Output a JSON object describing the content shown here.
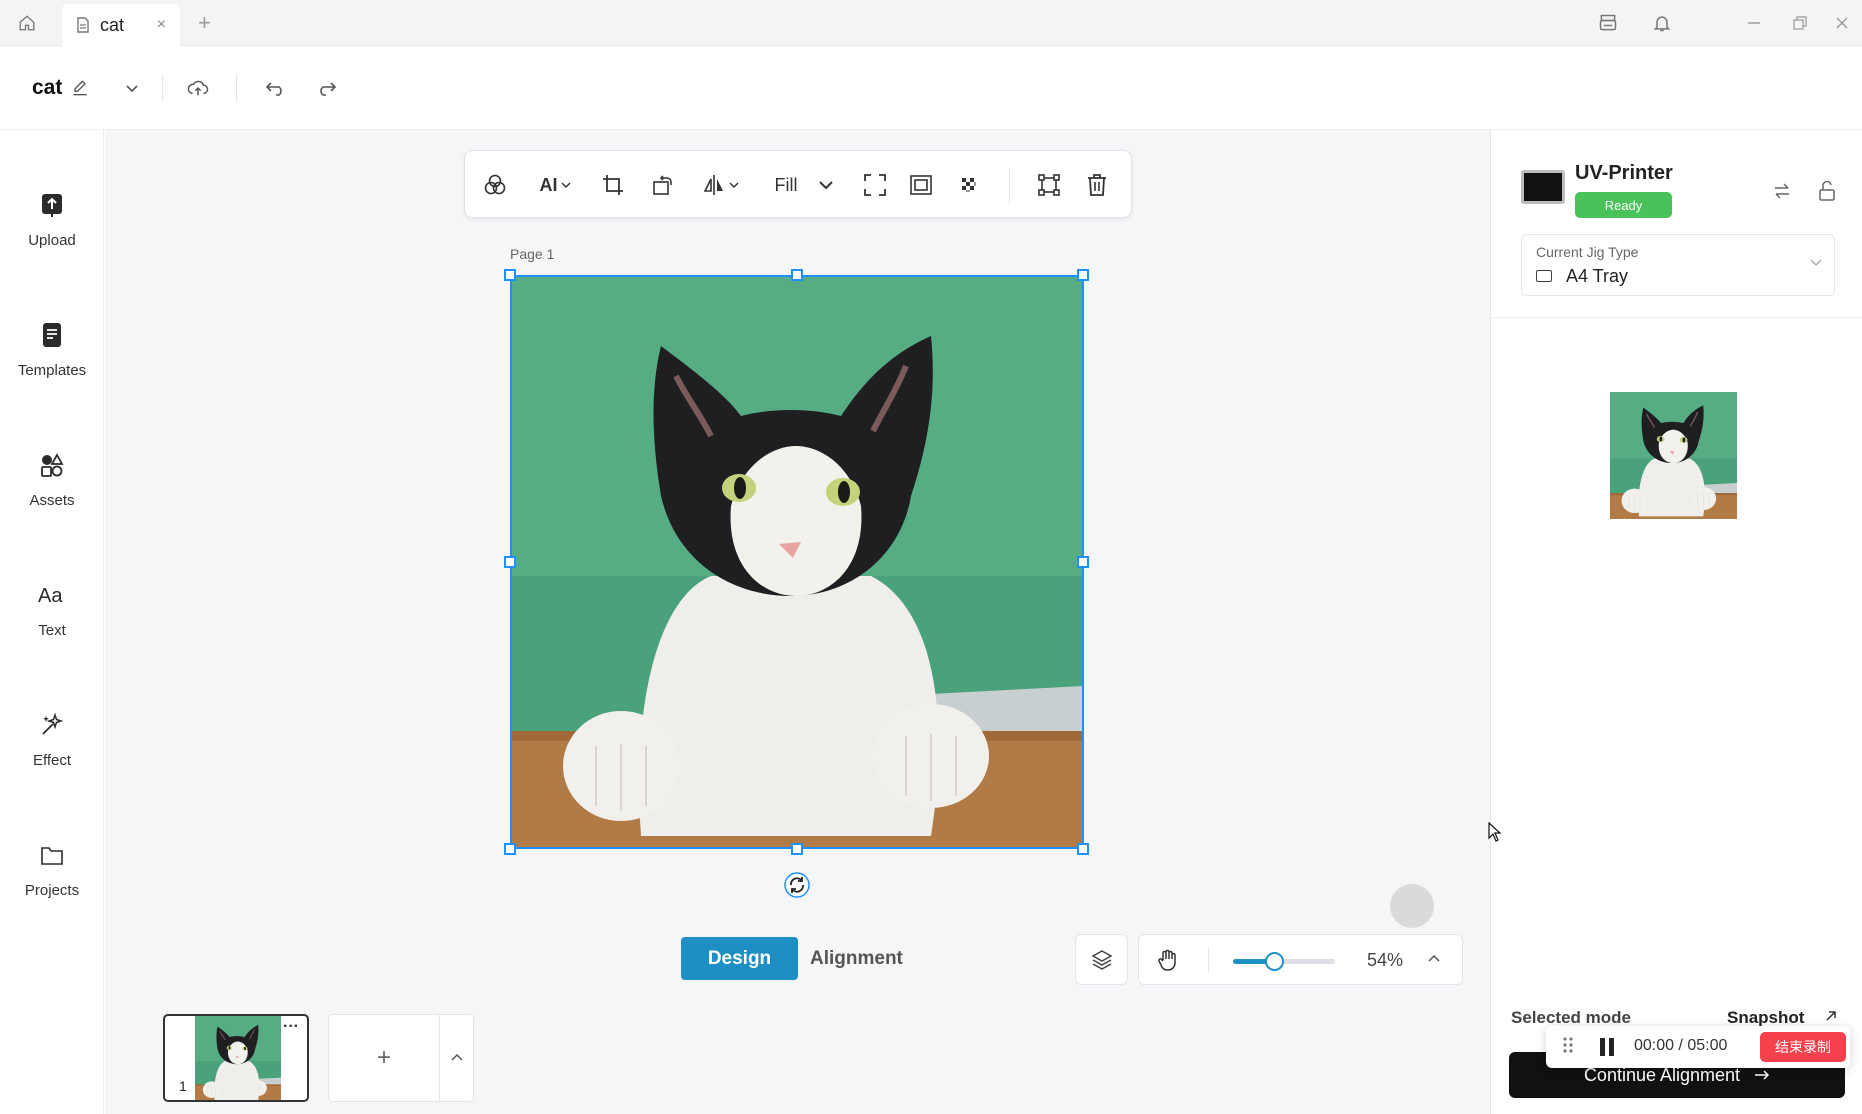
{
  "titlebar": {
    "tab_label": "cat",
    "tab_close": "×",
    "new_tab": "+"
  },
  "header": {
    "doc_title": "cat"
  },
  "sidebar": {
    "items": [
      {
        "label": "Upload",
        "icon": "upload-icon"
      },
      {
        "label": "Templates",
        "icon": "templates-icon"
      },
      {
        "label": "Assets",
        "icon": "assets-icon"
      },
      {
        "label": "Text",
        "icon": "text-icon"
      },
      {
        "label": "Effect",
        "icon": "effect-icon"
      },
      {
        "label": "Projects",
        "icon": "folder-icon"
      }
    ]
  },
  "toolbar": {
    "ai_label": "AI",
    "fill_label": "Fill"
  },
  "canvas": {
    "page_label": "Page 1"
  },
  "modes": {
    "design": "Design",
    "alignment": "Alignment",
    "active": "Design"
  },
  "zoom": {
    "value_label": "54%",
    "slider_fraction": 0.4
  },
  "pages": {
    "thumb_number": "1",
    "thumb_more": "···",
    "add_label": "+"
  },
  "printer": {
    "name": "UV-Printer",
    "status": "Ready",
    "status_color": "#4ac25a",
    "jig_label": "Current Jig Type",
    "jig_value": "A4 Tray"
  },
  "footer": {
    "selected_mode": "Selected mode",
    "snapshot": "Snapshot",
    "continue_label": "Continue Alignment"
  },
  "recording": {
    "time": "00:00 / 05:00",
    "stop_label": "结束录制",
    "stop_color": "#f4414b"
  },
  "colors": {
    "accent": "#1d8fc4",
    "selection": "#1e90ff"
  }
}
